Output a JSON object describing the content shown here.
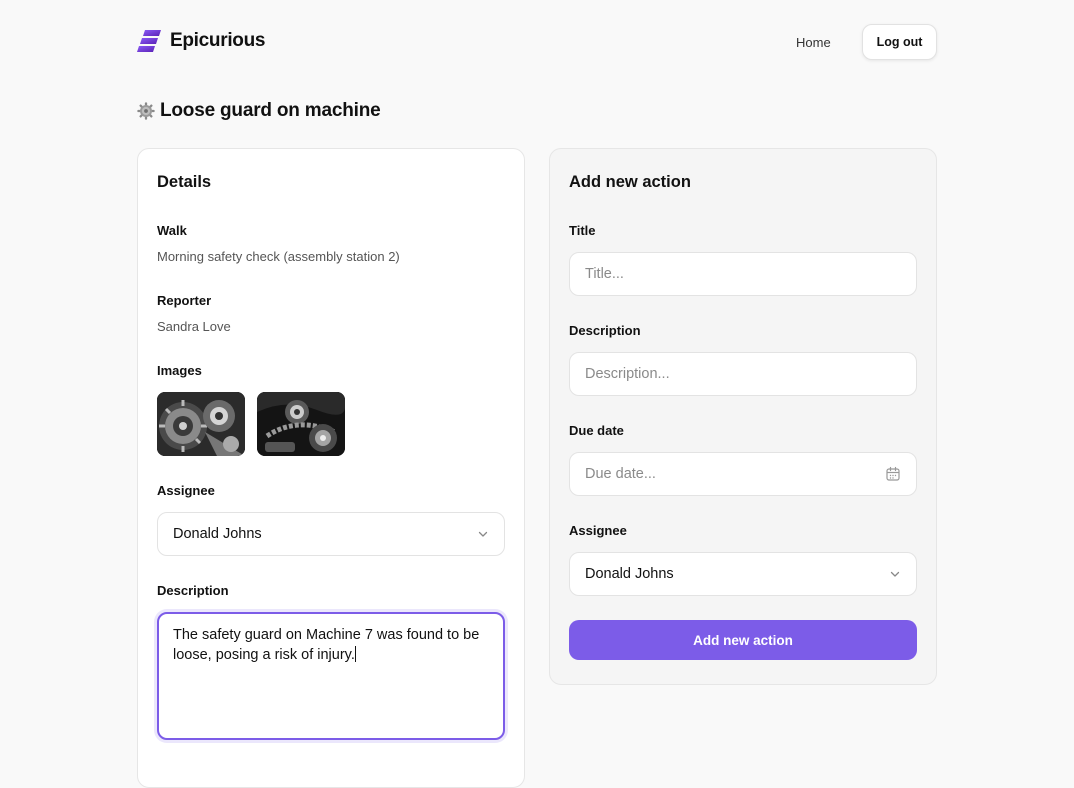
{
  "header": {
    "brand": "Epicurious",
    "nav_home": "Home",
    "logout_label": "Log out"
  },
  "page": {
    "title": "Loose guard on machine",
    "title_icon": "gear-emoji"
  },
  "details": {
    "heading": "Details",
    "walk_label": "Walk",
    "walk_value": "Morning safety check (assembly station 2)",
    "reporter_label": "Reporter",
    "reporter_value": "Sandra Love",
    "images_label": "Images",
    "images": [
      "machine-gears-photo",
      "machine-chain-photo"
    ],
    "assignee_label": "Assignee",
    "assignee_value": "Donald Johns",
    "description_label": "Description",
    "description_value": "The safety guard on Machine 7 was found to be loose, posing a risk of injury."
  },
  "new_action": {
    "heading": "Add new action",
    "title_label": "Title",
    "title_placeholder": "Title...",
    "description_label": "Description",
    "description_placeholder": "Description...",
    "due_date_label": "Due date",
    "due_date_placeholder": "Due date...",
    "assignee_label": "Assignee",
    "assignee_value": "Donald Johns",
    "submit_label": "Add new action"
  },
  "colors": {
    "accent": "#7c5ce8",
    "background": "#f9f9f9",
    "card": "#ffffff",
    "card_alt": "#f5f5f5"
  }
}
